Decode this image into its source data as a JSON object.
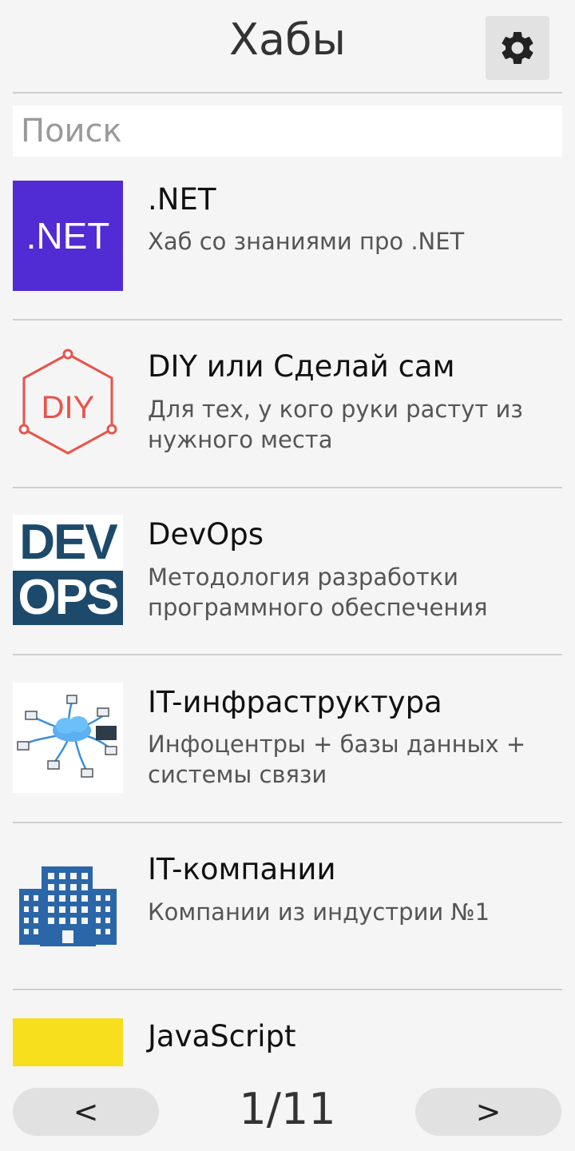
{
  "header": {
    "title": "Хабы",
    "settings_icon": "gear-icon"
  },
  "search": {
    "placeholder": "Поиск",
    "value": ""
  },
  "hubs": [
    {
      "title": ".NET",
      "description": "Хаб со знаниями про .NET",
      "logo_text": ".NET",
      "logo_bg": "#512bd4"
    },
    {
      "title": "DIY или Сделай сам",
      "description": "Для тех, у кого руки растут из нужного места",
      "logo_text": "DIY",
      "logo_color": "#e8534a"
    },
    {
      "title": "DevOps",
      "description": "Методология разработки программного обеспечения",
      "logo_text_1": "DEV",
      "logo_text_2": "OPS",
      "logo_color": "#1d4a6b"
    },
    {
      "title": "IT-инфраструктура",
      "description": "Инфоцентры + базы данных + системы связи",
      "logo_icon": "network-icon"
    },
    {
      "title": "IT-компании",
      "description": "Компании из индустрии №1",
      "logo_icon": "buildings-icon",
      "logo_color": "#2a66a8"
    },
    {
      "title": "JavaScript",
      "logo_color": "#f7df1e"
    }
  ],
  "pager": {
    "prev_label": "<",
    "page": "1/11",
    "next_label": ">"
  }
}
